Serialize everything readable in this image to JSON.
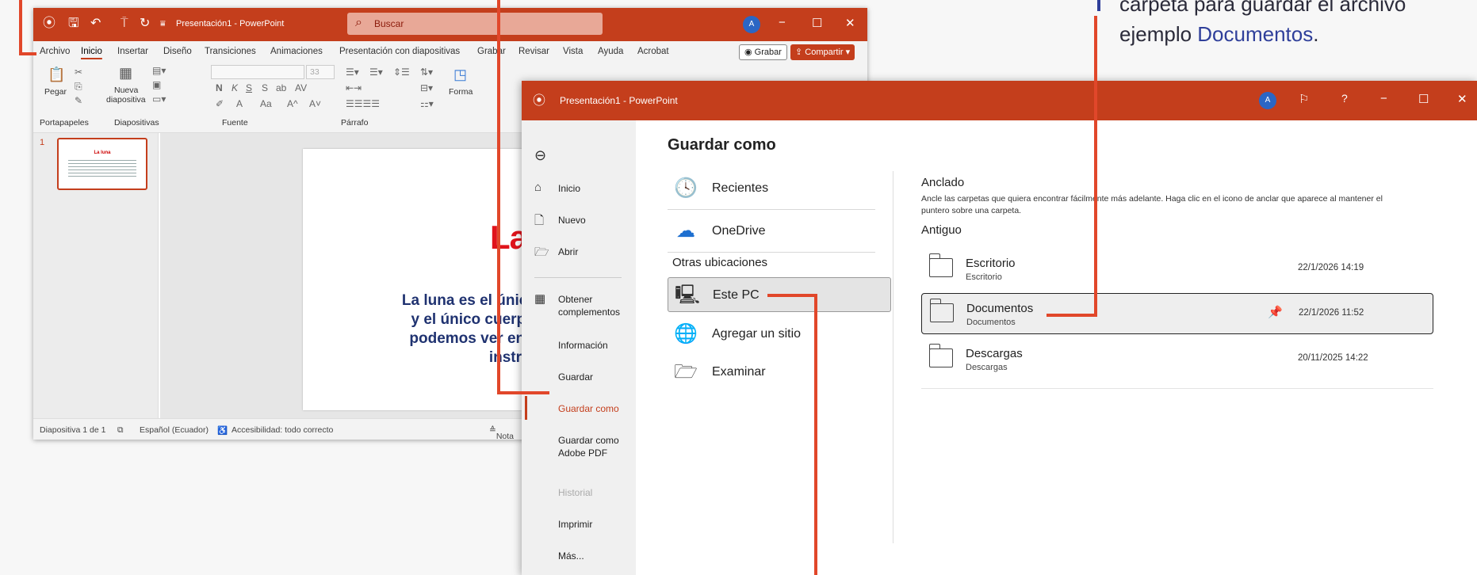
{
  "ppt_window": {
    "title": "Presentación1 - PowerPoint",
    "search_placeholder": "Buscar",
    "avatar_initial": "A",
    "tabs": [
      "Archivo",
      "Inicio",
      "Insertar",
      "Diseño",
      "Transiciones",
      "Animaciones",
      "Presentación con diapositivas",
      "Grabar",
      "Revisar",
      "Vista",
      "Ayuda",
      "Acrobat"
    ],
    "active_tab": "Inicio",
    "record_button": "Grabar",
    "share_button": "Compartir",
    "ribbon": {
      "paste_label": "Pegar",
      "new_slide_label": "Nueva",
      "new_slide_label2": "diapositiva",
      "groups": [
        "Portapapeles",
        "Diapositivas",
        "Fuente",
        "Párrafo"
      ],
      "font_size": "33",
      "format_partial": "Forma"
    },
    "slide_number": "1",
    "slide": {
      "title_partial": "La lu",
      "body_lines": [
        "La luna es el único satélit",
        "y el único cuerpo del S",
        "podemos ver en detalle",
        "instrumentos"
      ]
    },
    "thumb_title": "La luna",
    "status": {
      "slide_count": "Diapositiva 1 de 1",
      "language": "Español (Ecuador)",
      "accessibility": "Accesibilidad: todo correcto",
      "notes_partial": "Nota"
    }
  },
  "saveas_window": {
    "title": "Presentación1 - PowerPoint",
    "avatar_initial": "A",
    "help": "?",
    "nav": [
      {
        "label": "Inicio",
        "icon": "home-icon"
      },
      {
        "label": "Nuevo",
        "icon": "new-file-icon"
      },
      {
        "label": "Abrir",
        "icon": "folder-open-icon"
      },
      {
        "label": "Obtener complementos",
        "icon": "addins-icon"
      },
      {
        "label": "Información"
      },
      {
        "label": "Guardar"
      },
      {
        "label": "Guardar como",
        "active": true
      },
      {
        "label": "Guardar como Adobe PDF"
      },
      {
        "label": "Historial",
        "disabled": true
      },
      {
        "label": "Imprimir"
      },
      {
        "label": "Más..."
      }
    ],
    "heading": "Guardar como",
    "locations": {
      "recent": "Recientes",
      "onedrive": "OneDrive",
      "other_header": "Otras ubicaciones",
      "this_pc": "Este PC",
      "add_site": "Agregar un sitio",
      "browse": "Examinar"
    },
    "pinned_title": "Anclado",
    "pinned_desc": "Ancle las carpetas que quiera encontrar fácilmente más adelante. Haga clic en el icono de anclar que aparece al mantener el puntero sobre una carpeta.",
    "older_title": "Antiguo",
    "folders": [
      {
        "name": "Escritorio",
        "path": "Escritorio",
        "date": "22/1/2026 14:19"
      },
      {
        "name": "Documentos",
        "path": "Documentos",
        "date": "22/1/2026 11:52",
        "selected": true
      },
      {
        "name": "Descargas",
        "path": "Descargas",
        "date": "20/11/2025 14:22"
      }
    ]
  },
  "callout": {
    "line1": "carpeta para guardar el archivo",
    "line2_prefix": "ejemplo ",
    "line2_highlight": "Documentos",
    "line2_suffix": "."
  },
  "colors": {
    "accent": "#c43e1c",
    "annotation_line": "#e1472a",
    "callout_highlight": "#2f3f9a",
    "slide_title": "#e0141c",
    "slide_body": "#1f3270"
  }
}
